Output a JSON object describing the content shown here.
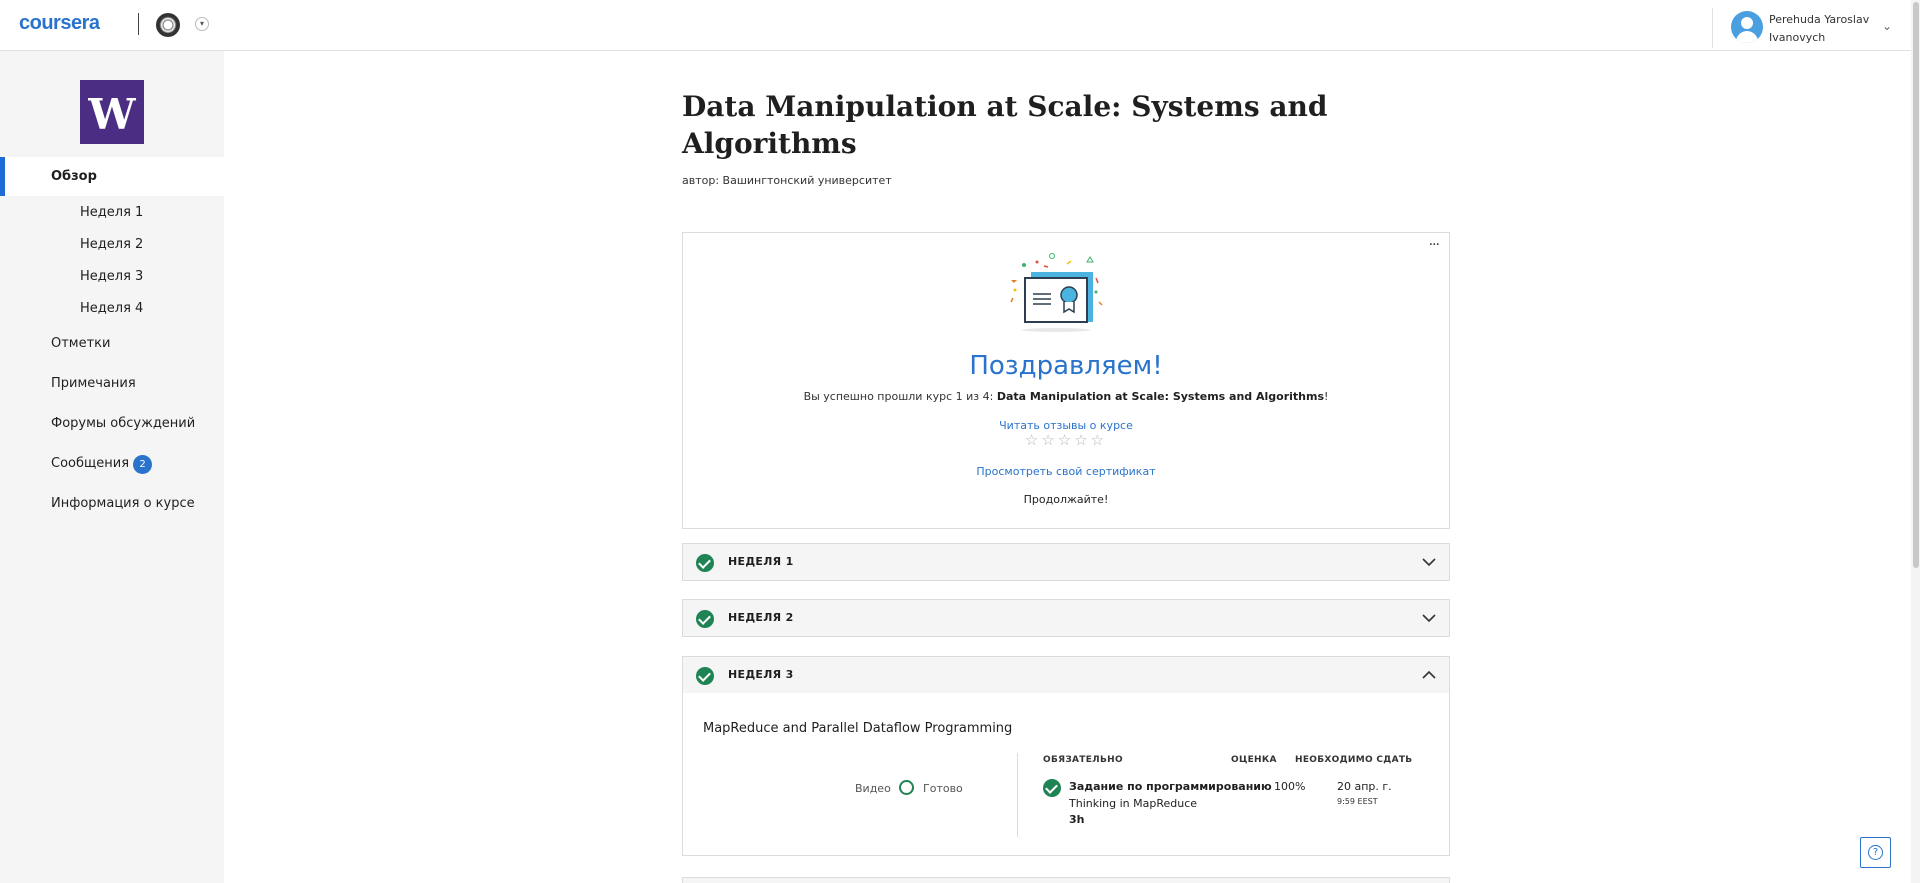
{
  "header": {
    "logo_text": "coursera",
    "user_name_line1": "Perehuda Yaroslav",
    "user_name_line2": "Ivanovych"
  },
  "sidebar": {
    "logo_letter": "W",
    "items": [
      {
        "label": "Обзор",
        "active": true
      },
      {
        "label": "Неделя 1"
      },
      {
        "label": "Неделя 2"
      },
      {
        "label": "Неделя 3"
      },
      {
        "label": "Неделя 4"
      },
      {
        "label": "Отметки"
      },
      {
        "label": "Примечания"
      },
      {
        "label": "Форумы обсуждений"
      },
      {
        "label": "Сообщения",
        "badge": "2"
      },
      {
        "label": "Информация о курсе"
      }
    ]
  },
  "course": {
    "title": "Data Manipulation at Scale: Systems and Algorithms",
    "author": "автор: Вашингтонский университет"
  },
  "congrats": {
    "menu": "···",
    "title": "Поздравляем!",
    "text_prefix": "Вы успешно прошли курс 1 из 4: ",
    "course_name": "Data Manipulation at Scale: Systems and Algorithms",
    "text_suffix": "!",
    "reviews_link": "Читать отзывы о курсе",
    "stars": "☆☆☆☆☆",
    "certificate_link": "Просмотреть свой сертификат",
    "continue_text": "Продолжайте!"
  },
  "weeks": [
    {
      "label": "НЕДЕЛЯ 1",
      "expanded": false
    },
    {
      "label": "НЕДЕЛЯ 2",
      "expanded": false
    },
    {
      "label": "НЕДЕЛЯ 3",
      "expanded": true
    }
  ],
  "week3": {
    "module_title": "MapReduce and Parallel Dataflow Programming",
    "video_label": "Видео",
    "done_label": "Готово",
    "columns": {
      "required": "ОБЯЗАТЕЛЬНО",
      "grade": "ОЦЕНКА",
      "due": "НЕОБХОДИМО СДАТЬ"
    },
    "assignment": {
      "title": "Задание по программированию",
      "subtitle": "Thinking in MapReduce",
      "duration": "3h",
      "grade": "100%",
      "due_date": "20 апр. г.",
      "due_time": "9:59 EEST"
    }
  },
  "help": {
    "label": "?"
  },
  "colors": {
    "accent": "#2a73cc",
    "success": "#1f8354",
    "uw_purple": "#4b2e83"
  }
}
